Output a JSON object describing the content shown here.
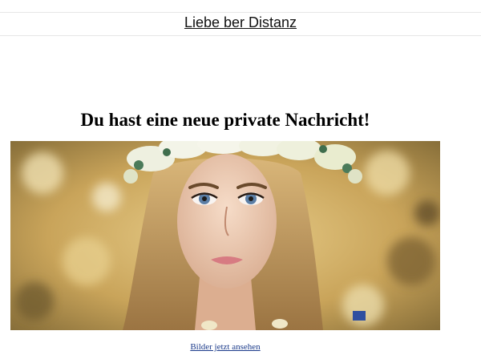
{
  "header": {
    "title": "Liebe ber Distanz"
  },
  "main": {
    "headline": "Du hast eine neue private Nachricht!",
    "cta_link": "Bilder jetzt ansehen"
  },
  "colors": {
    "link": "#1a3a8a",
    "headline": "#000000"
  }
}
